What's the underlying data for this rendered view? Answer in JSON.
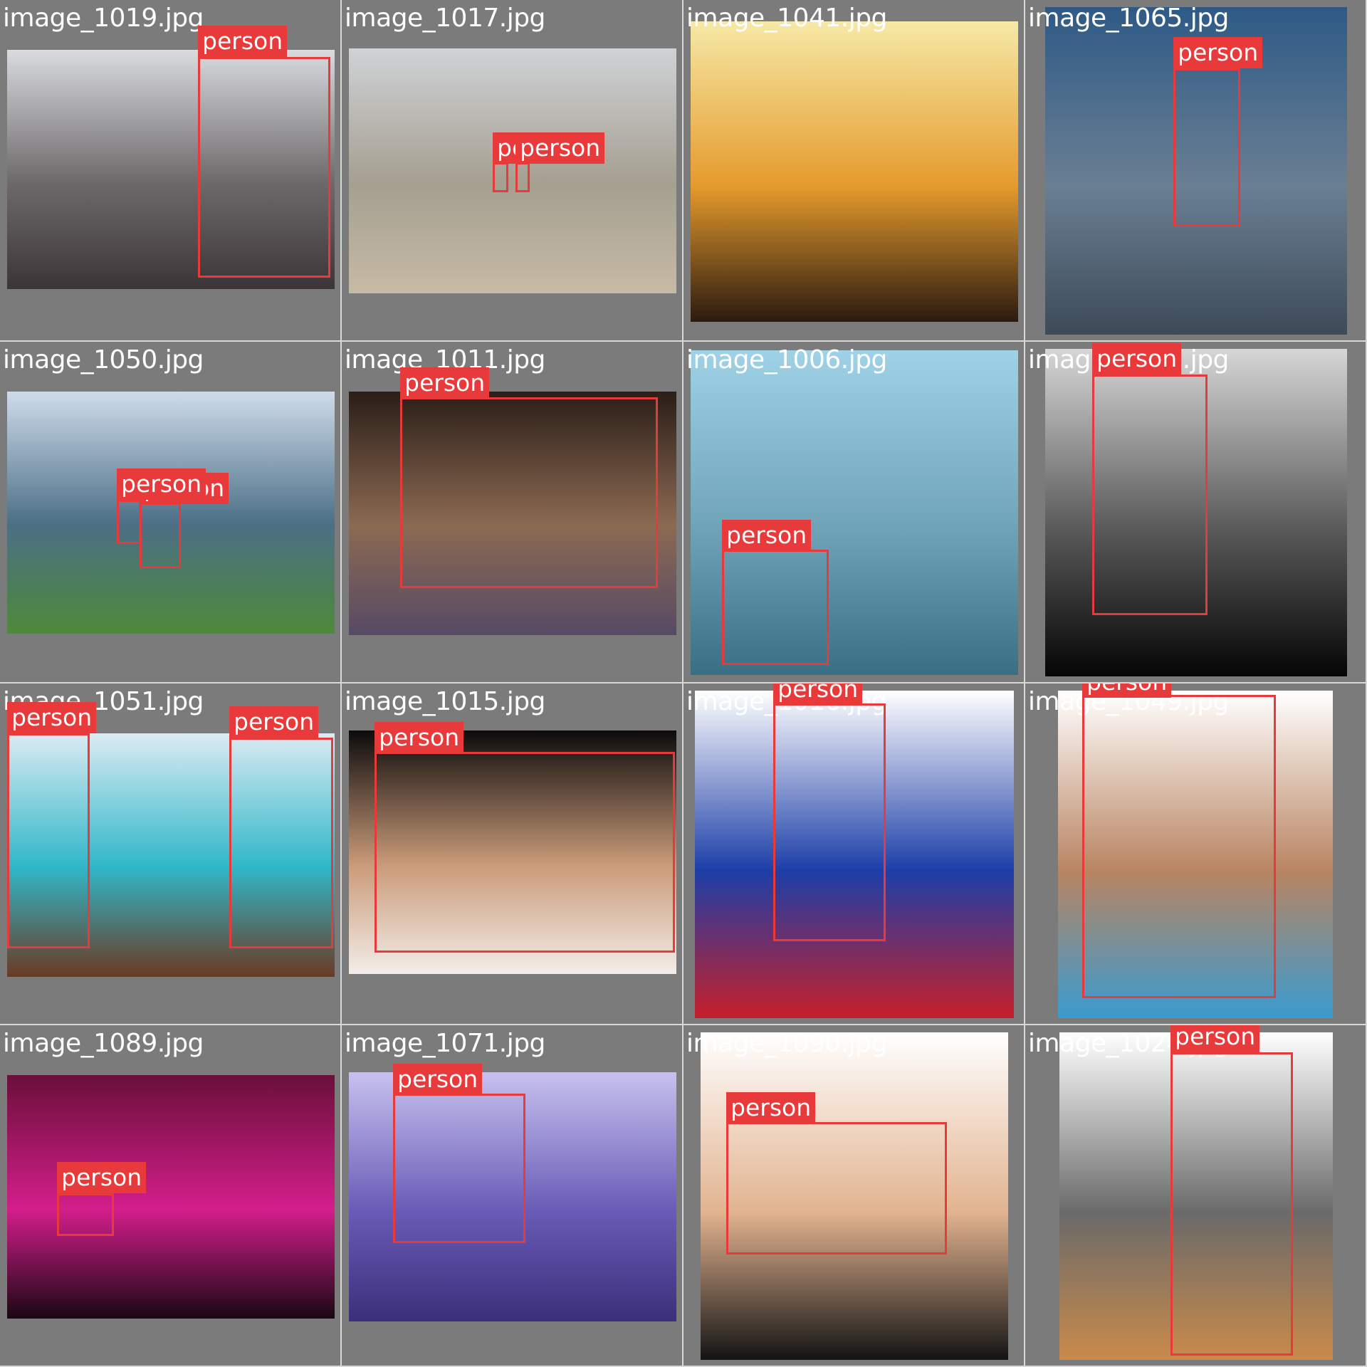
{
  "detection_label": "person",
  "box_color": "#e83a3a",
  "tiles": [
    {
      "filename": "image_1019.jpg",
      "photo_colors": [
        "#d9dbdf",
        "#6e6a6c",
        "#3b3537"
      ],
      "detections": 1
    },
    {
      "filename": "image_1017.jpg",
      "photo_colors": [
        "#cfd2d6",
        "#a59f90",
        "#c6bba6"
      ],
      "detections": 2
    },
    {
      "filename": "image_1041.jpg",
      "photo_colors": [
        "#f6e9a6",
        "#e59a2c",
        "#2b1a10"
      ],
      "detections": 0
    },
    {
      "filename": "image_1065.jpg",
      "photo_colors": [
        "#2e5a86",
        "#6a7f93",
        "#3d4a58"
      ],
      "detections": 1
    },
    {
      "filename": "image_1050.jpg",
      "photo_colors": [
        "#cfdcea",
        "#4b6f86",
        "#4e8a3a"
      ],
      "detections": 2
    },
    {
      "filename": "image_1011.jpg",
      "photo_colors": [
        "#2a1e18",
        "#8c6a52",
        "#574a66"
      ],
      "detections": 1
    },
    {
      "filename": "image_1006.jpg",
      "photo_colors": [
        "#9fd2e6",
        "#6fa3b7",
        "#3a6f83"
      ],
      "detections": 1
    },
    {
      "filename": "image_1082.jpg",
      "photo_colors": [
        "#d6d6d6",
        "#5a5a5a",
        "#050505"
      ],
      "detections": 1
    },
    {
      "filename": "image_1051.jpg",
      "photo_colors": [
        "#dcebf2",
        "#2fb7c9",
        "#6b3a24"
      ],
      "detections": 2
    },
    {
      "filename": "image_1015.jpg",
      "photo_colors": [
        "#0c0b0c",
        "#c99a78",
        "#f3ede8"
      ],
      "detections": 1
    },
    {
      "filename": "image_1016.jpg",
      "photo_colors": [
        "#ffffff",
        "#1d3ea8",
        "#c5202a"
      ],
      "detections": 1
    },
    {
      "filename": "image_1049.jpg",
      "photo_colors": [
        "#ffffff",
        "#b98461",
        "#3a9bd0"
      ],
      "detections": 1
    },
    {
      "filename": "image_1089.jpg",
      "photo_colors": [
        "#6a0f3a",
        "#d41e8c",
        "#1a0712"
      ],
      "detections": 1
    },
    {
      "filename": "image_1071.jpg",
      "photo_colors": [
        "#c7c1ee",
        "#6a5cb8",
        "#3b2f7a"
      ],
      "detections": 1
    },
    {
      "filename": "image_1090.jpg",
      "photo_colors": [
        "#ffffff",
        "#e2b38f",
        "#141414"
      ],
      "detections": 1
    },
    {
      "filename": "image_1024.jpg",
      "photo_colors": [
        "#ffffff",
        "#6a6a6a",
        "#c98a4a"
      ],
      "detections": 1
    }
  ]
}
